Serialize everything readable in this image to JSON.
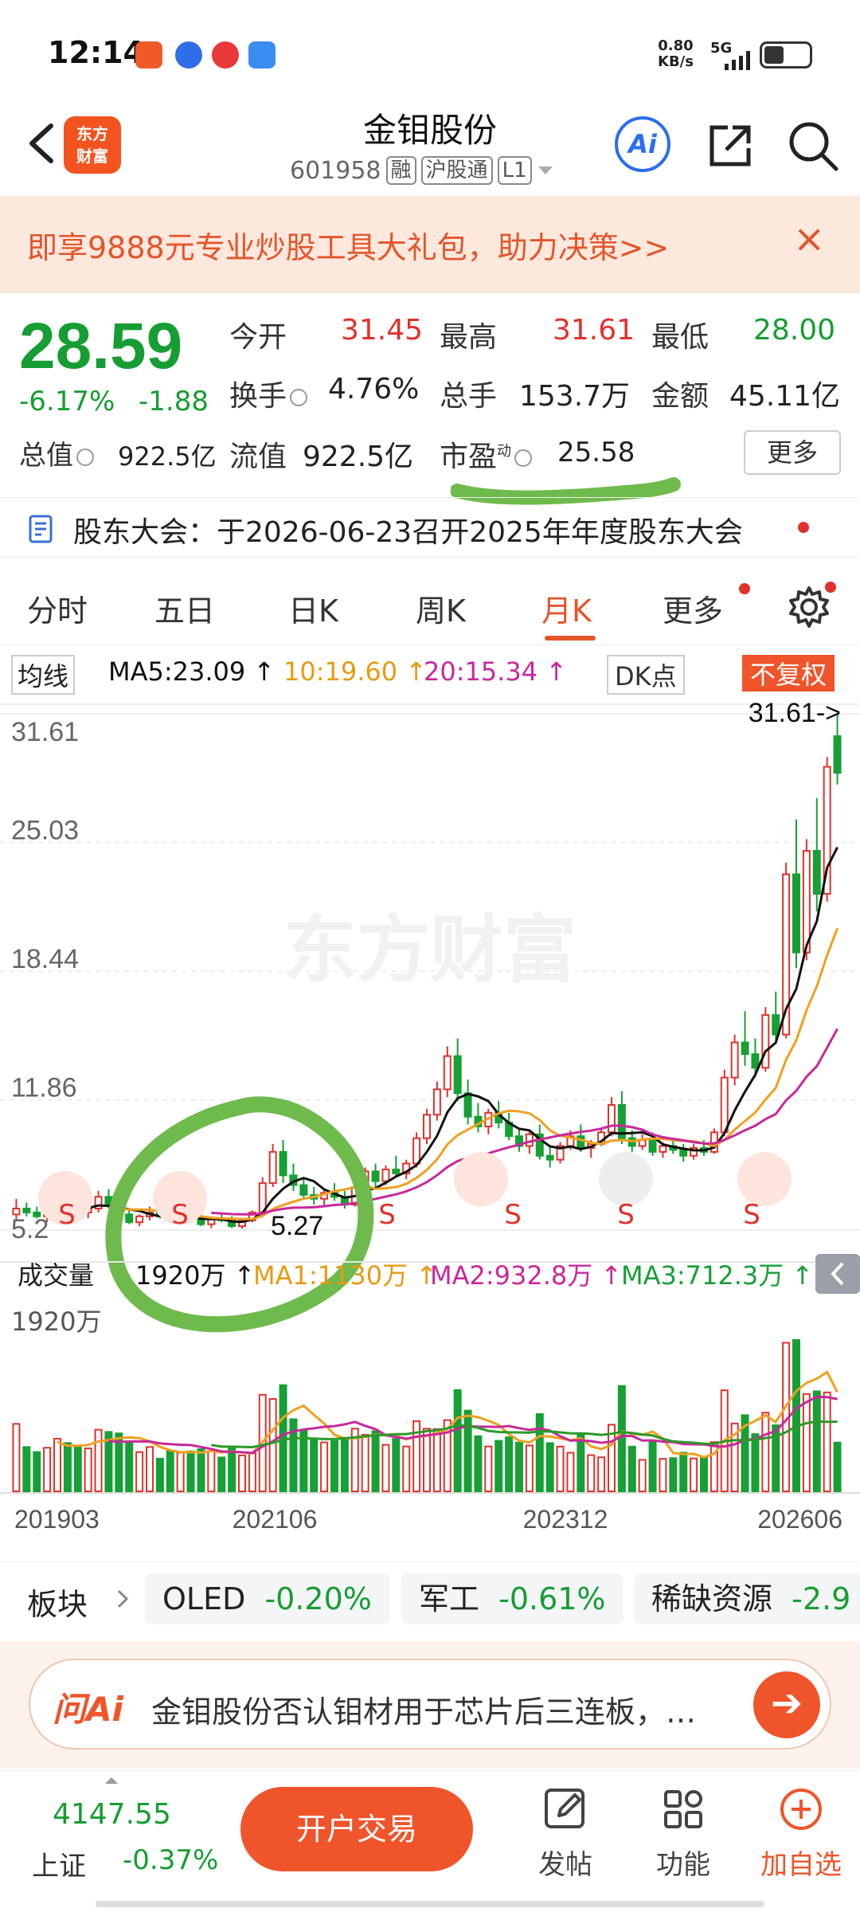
{
  "status_bar": {
    "time": "12:14",
    "net_speed_value": "0.80",
    "net_speed_unit": "KB/s",
    "network": "5G",
    "battery_percent": 45
  },
  "header": {
    "stock_name": "金钼股份",
    "stock_code": "601958",
    "tags": [
      "融",
      "沪股通",
      "L1"
    ],
    "logo_line1": "东方",
    "logo_line2": "财富",
    "ai_label": "Ai"
  },
  "banner": {
    "text": "即享9888元专业炒股工具大礼包，助力决策>>",
    "close": "×"
  },
  "quote": {
    "price": "28.59",
    "change_pct": "-6.17%",
    "change": "-1.88",
    "open_label": "今开",
    "open": "31.45",
    "high_label": "最高",
    "high": "31.61",
    "low_label": "最低",
    "low": "28.00",
    "turnover_label": "换手",
    "turnover": "4.76%",
    "volume_label": "总手",
    "volume": "153.7万",
    "amount_label": "金额",
    "amount": "45.11亿",
    "mktcap_label": "总值",
    "mktcap": "922.5亿",
    "float_label": "流值",
    "float": "922.5亿",
    "pe_label": "市盈",
    "pe_sup": "动",
    "pe": "25.58",
    "more_label": "更多"
  },
  "announcement": {
    "text": "股东大会：于2026-06-23召开2025年年度股东大会"
  },
  "tabs": [
    {
      "label": "分时"
    },
    {
      "label": "五日"
    },
    {
      "label": "日K"
    },
    {
      "label": "周K"
    },
    {
      "label": "月K",
      "active": true
    },
    {
      "label": "更多"
    }
  ],
  "ma_row": {
    "ma_label": "均线",
    "ma5": "MA5:23.09 ↑",
    "ma10": "10:19.60 ↑",
    "ma20": "20:15.34 ↑",
    "dk_label": "DK点",
    "fq_label": "不复权"
  },
  "chart": {
    "y_ticks": [
      "31.61",
      "25.03",
      "18.44",
      "11.86",
      "5.2"
    ],
    "high_marker": "31.61->",
    "low_marker": "5.27",
    "x_ticks": [
      "201903",
      "202106",
      "202312",
      "202606"
    ],
    "vol_max_label": "1920万",
    "colors": {
      "up": "#e0312c",
      "down": "#16a035",
      "ma5": "#111111",
      "ma10": "#f0a020",
      "ma20": "#c8289c",
      "vol_ma3": "#2a9a2a"
    }
  },
  "chart_data": {
    "type": "candlestick",
    "period": "monthly",
    "ylim": [
      5.2,
      31.61
    ],
    "candles": [
      [
        6.0,
        6.8,
        5.7,
        6.3
      ],
      [
        6.3,
        6.6,
        5.9,
        6.1
      ],
      [
        6.1,
        6.4,
        5.8,
        5.9
      ],
      [
        5.9,
        6.3,
        5.6,
        6.2
      ],
      [
        6.2,
        6.9,
        6.0,
        6.6
      ],
      [
        6.6,
        7.0,
        6.2,
        6.4
      ],
      [
        6.4,
        6.7,
        6.0,
        6.1
      ],
      [
        6.1,
        6.5,
        5.8,
        6.3
      ],
      [
        6.3,
        7.2,
        6.1,
        6.9
      ],
      [
        6.9,
        7.3,
        6.3,
        6.5
      ],
      [
        6.5,
        6.8,
        5.9,
        6.0
      ],
      [
        6.0,
        6.2,
        5.5,
        5.6
      ],
      [
        5.6,
        6.0,
        5.4,
        5.9
      ],
      [
        5.9,
        6.4,
        5.7,
        6.1
      ],
      [
        6.1,
        6.3,
        5.8,
        5.9
      ],
      [
        5.9,
        6.2,
        5.6,
        5.7
      ],
      [
        5.7,
        6.1,
        5.5,
        6.0
      ],
      [
        6.0,
        6.3,
        5.7,
        5.8
      ],
      [
        5.8,
        6.0,
        5.4,
        5.5
      ],
      [
        5.5,
        5.9,
        5.3,
        5.8
      ],
      [
        5.8,
        6.1,
        5.6,
        5.7
      ],
      [
        5.7,
        5.9,
        5.3,
        5.4
      ],
      [
        5.4,
        5.8,
        5.27,
        5.7
      ],
      [
        5.7,
        6.2,
        5.6,
        6.1
      ],
      [
        6.1,
        7.9,
        6.0,
        7.6
      ],
      [
        7.6,
        9.6,
        7.4,
        9.2
      ],
      [
        9.2,
        9.8,
        7.6,
        8.0
      ],
      [
        8.0,
        8.6,
        7.2,
        7.5
      ],
      [
        7.5,
        7.9,
        6.8,
        7.0
      ],
      [
        7.0,
        7.4,
        6.5,
        6.8
      ],
      [
        6.8,
        7.3,
        6.4,
        7.1
      ],
      [
        7.1,
        7.6,
        6.7,
        6.9
      ],
      [
        6.9,
        7.2,
        6.3,
        6.5
      ],
      [
        6.5,
        7.6,
        6.4,
        7.4
      ],
      [
        7.4,
        8.4,
        7.2,
        8.2
      ],
      [
        8.2,
        8.6,
        7.4,
        7.7
      ],
      [
        7.7,
        8.5,
        7.5,
        8.3
      ],
      [
        8.3,
        9.0,
        7.9,
        8.1
      ],
      [
        8.1,
        8.8,
        7.8,
        8.6
      ],
      [
        8.6,
        10.2,
        8.4,
        9.9
      ],
      [
        9.9,
        11.4,
        9.6,
        11.1
      ],
      [
        11.1,
        12.8,
        10.8,
        12.4
      ],
      [
        12.4,
        14.6,
        12.0,
        14.1
      ],
      [
        14.1,
        15.0,
        11.8,
        12.2
      ],
      [
        12.2,
        12.9,
        10.6,
        11.0
      ],
      [
        11.0,
        11.7,
        10.2,
        10.5
      ],
      [
        10.5,
        11.4,
        10.1,
        11.2
      ],
      [
        11.2,
        11.8,
        10.4,
        10.7
      ],
      [
        10.7,
        11.2,
        9.8,
        10.0
      ],
      [
        10.0,
        10.4,
        9.2,
        9.5
      ],
      [
        9.5,
        10.3,
        9.1,
        10.1
      ],
      [
        10.1,
        10.6,
        8.8,
        9.0
      ],
      [
        9.0,
        9.5,
        8.4,
        8.8
      ],
      [
        8.8,
        9.7,
        8.6,
        9.5
      ],
      [
        9.5,
        10.3,
        9.3,
        10.0
      ],
      [
        10.0,
        10.6,
        9.2,
        9.4
      ],
      [
        9.4,
        9.8,
        8.9,
        9.6
      ],
      [
        9.6,
        10.4,
        9.5,
        10.2
      ],
      [
        10.2,
        12.0,
        10.0,
        11.6
      ],
      [
        11.6,
        12.3,
        9.6,
        9.9
      ],
      [
        9.9,
        10.3,
        9.2,
        9.5
      ],
      [
        9.5,
        10.1,
        9.3,
        9.8
      ],
      [
        9.8,
        10.2,
        9.0,
        9.2
      ],
      [
        9.2,
        9.7,
        8.9,
        9.5
      ],
      [
        9.5,
        9.9,
        9.1,
        9.3
      ],
      [
        9.3,
        9.6,
        8.7,
        9.0
      ],
      [
        9.0,
        9.6,
        8.8,
        9.4
      ],
      [
        9.4,
        9.8,
        9.0,
        9.2
      ],
      [
        9.2,
        10.4,
        9.1,
        10.2
      ],
      [
        10.2,
        13.4,
        10.0,
        13.0
      ],
      [
        13.0,
        15.2,
        12.6,
        14.8
      ],
      [
        14.8,
        16.4,
        13.6,
        14.2
      ],
      [
        14.2,
        15.0,
        13.0,
        13.5
      ],
      [
        13.5,
        16.6,
        13.3,
        16.2
      ],
      [
        16.2,
        17.4,
        14.8,
        15.2
      ],
      [
        15.2,
        24.0,
        15.0,
        23.4
      ],
      [
        23.4,
        26.2,
        18.6,
        19.4
      ],
      [
        19.4,
        25.2,
        19.0,
        24.6
      ],
      [
        24.6,
        27.3,
        21.5,
        22.4
      ],
      [
        22.4,
        29.4,
        22.0,
        28.9
      ],
      [
        30.47,
        31.61,
        28.0,
        28.59
      ]
    ],
    "volume_max": "1920万"
  },
  "volume_row": {
    "label": "成交量",
    "vol": "1920万 ↑",
    "ma1": "MA1:1130万 ↑",
    "ma2": "MA2:932.8万 ↑",
    "ma3": "MA3:712.3万 ↑"
  },
  "sectors": {
    "label": "板块",
    "items": [
      {
        "name": "OLED",
        "change": "-0.20%"
      },
      {
        "name": "军工",
        "change": "-0.61%"
      },
      {
        "name": "稀缺资源",
        "change": "-2.9"
      }
    ]
  },
  "ask_ai": {
    "logo": "问Ai",
    "text": "金钼股份否认钼材用于芯片后三连板，…"
  },
  "bottom_nav": {
    "index_value": "4147.55",
    "index_name": "上证",
    "index_change": "-0.37%",
    "trade_label": "开户交易",
    "items": [
      {
        "label": "发帖"
      },
      {
        "label": "功能"
      },
      {
        "label": "加自选"
      }
    ]
  }
}
